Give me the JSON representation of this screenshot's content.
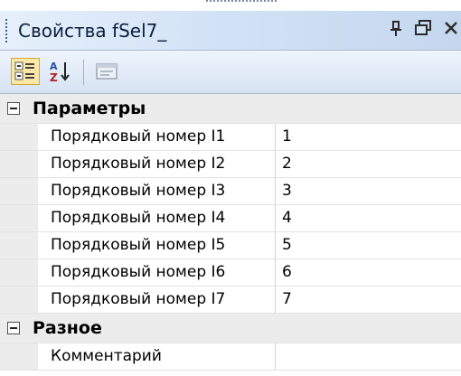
{
  "window": {
    "title": "Свойства fSel7_",
    "pin_icon": "pin-icon",
    "restore_icon": "restore-icon",
    "close_icon": "close-icon"
  },
  "toolbar": {
    "buttons": [
      {
        "name": "categorized-button",
        "icon": "categorized-icon",
        "active": true
      },
      {
        "name": "alphabetical-button",
        "icon": "sort-az-icon",
        "active": false
      },
      {
        "name": "property-pages-button",
        "icon": "property-pages-icon",
        "enabled": false
      }
    ]
  },
  "categories": [
    {
      "label": "Параметры",
      "expanded": true,
      "rows": [
        {
          "name": "Порядковый номер I1",
          "value": "1"
        },
        {
          "name": "Порядковый номер I2",
          "value": "2"
        },
        {
          "name": "Порядковый номер I3",
          "value": "3"
        },
        {
          "name": "Порядковый номер I4",
          "value": "4"
        },
        {
          "name": "Порядковый номер I5",
          "value": "5"
        },
        {
          "name": "Порядковый номер I6",
          "value": "6"
        },
        {
          "name": "Порядковый номер I7",
          "value": "7"
        }
      ]
    },
    {
      "label": "Разное",
      "expanded": true,
      "rows": [
        {
          "name": "Комментарий",
          "value": ""
        }
      ]
    }
  ],
  "colors": {
    "titlebar": "#d3e3f6",
    "category_bg": "#ececec",
    "active_tool": "#fbe7a6"
  }
}
